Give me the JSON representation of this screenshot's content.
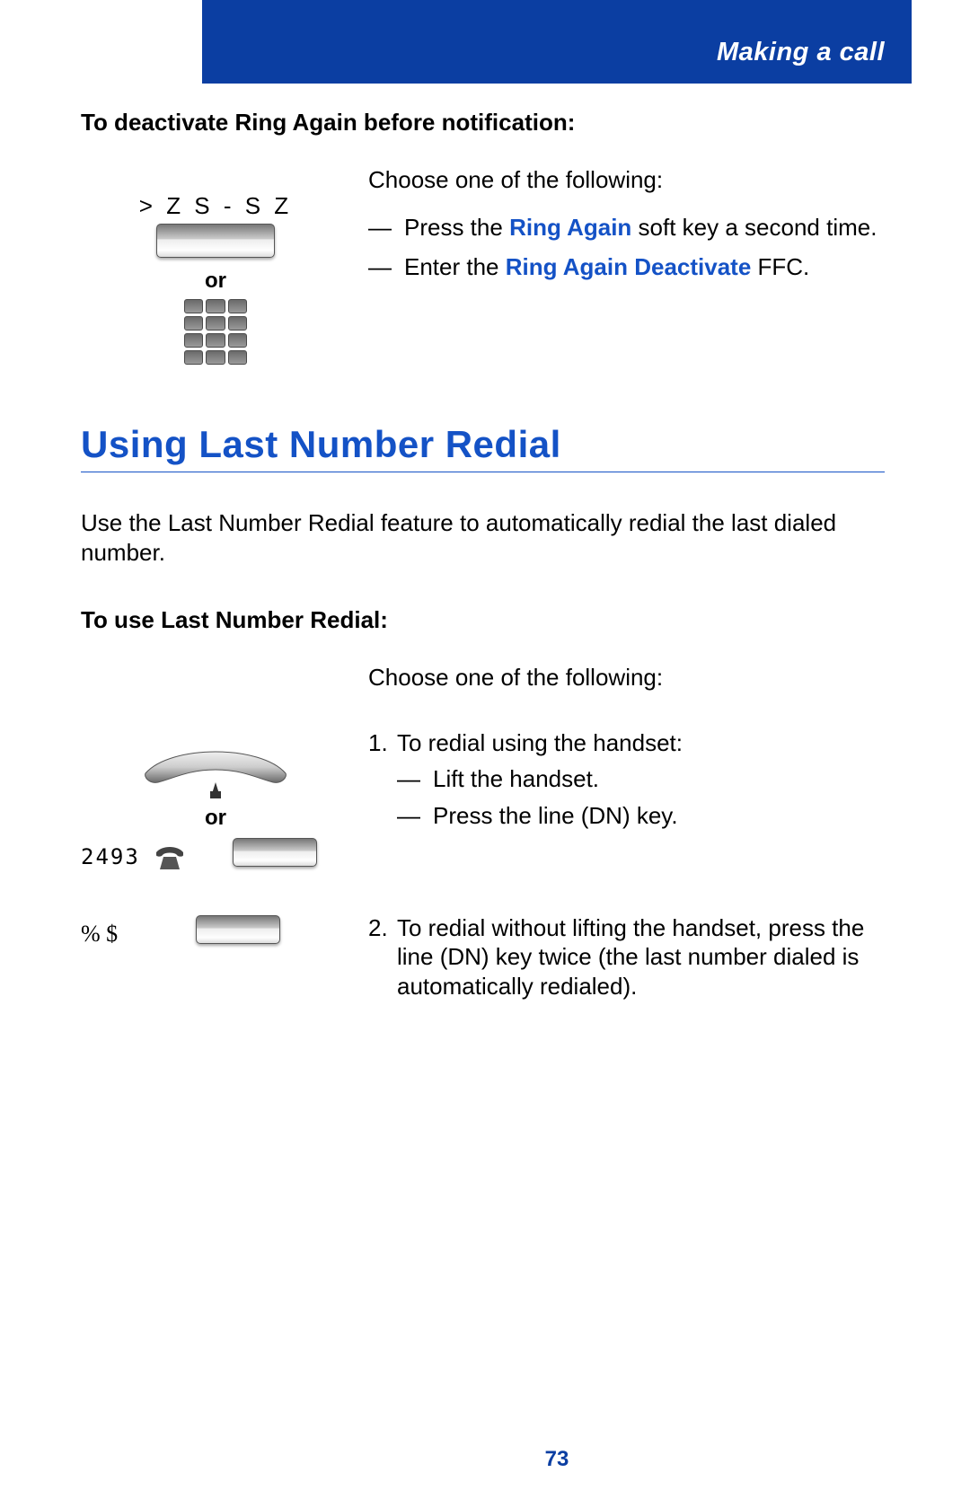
{
  "header": {
    "title": "Making a call"
  },
  "footer": {
    "page_number": "73"
  },
  "deactivate": {
    "heading": "To deactivate Ring Again before notification:",
    "softkey_label": "> Z S - S Z",
    "or": "or",
    "intro": "Choose one of the following:",
    "item1_pre": "Press the ",
    "item1_kw": "Ring Again",
    "item1_post": " soft key a second time.",
    "item2_pre": "Enter the ",
    "item2_kw": "Ring Again Deactivate",
    "item2_post": " FFC."
  },
  "redial": {
    "title": "Using Last Number Redial",
    "intro": "Use the Last Number Redial feature to automatically redial the last dialed number.",
    "subhead": "To use Last Number Redial:",
    "choose": "Choose one of the following:",
    "step1_num": "1.",
    "step1_title": "To redial using the handset:",
    "step1_a": "Lift the handset.",
    "step1_b": "Press the line (DN) key.",
    "step2_num": "2.",
    "step2_text": "To redial without lifting the handset, press the line (DN) key twice (the last number dialed is automatically redialed).",
    "line_number": "2493",
    "or": "or",
    "dn_label": "% $"
  }
}
